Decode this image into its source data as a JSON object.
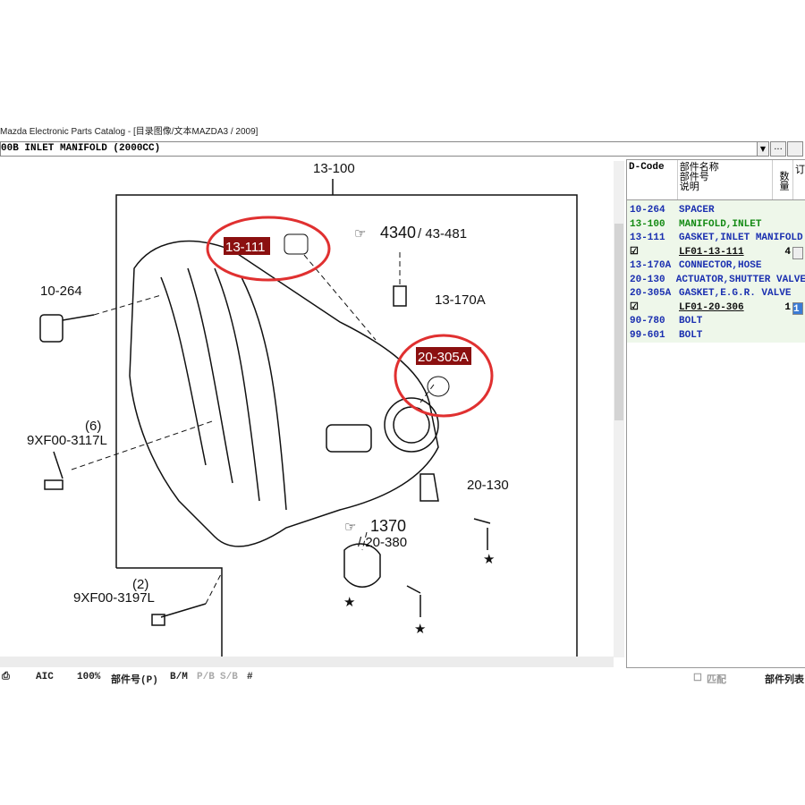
{
  "window": {
    "title": "Mazda Electronic Parts Catalog - [目录图像/文本MAZDA3 / 2009]"
  },
  "combo": {
    "value": "00B  INLET MANIFOLD (2000CC)",
    "more_label": "..."
  },
  "diagram": {
    "labels": {
      "main": "13-100",
      "gasket": "13-111",
      "ref1": "4340",
      "ref1b": "/ 43-481",
      "conn": "13-170A",
      "spacer": "10-264",
      "egr": "20-305A",
      "bolt1": "9XF00-3117L",
      "bolt1qty": "(6)",
      "act": "20-130",
      "ref2": "1370",
      "ref2b": "/ 20-380",
      "bolt2qty": "(2)",
      "bolt2": "9XF00-3197L",
      "star": "★"
    },
    "highlight_color": "#8b1010",
    "circle_color": "#e03030"
  },
  "panel": {
    "headers": {
      "dcode": "D-Code",
      "name": "部件名称",
      "partno": "部件号",
      "desc": "说明",
      "qty": "数量",
      "order": "订"
    },
    "rows": [
      {
        "code": "10-264",
        "name": "SPACER",
        "color": "blue"
      },
      {
        "code": "13-100",
        "name": "MANIFOLD,INLET",
        "color": "green"
      },
      {
        "code": "13-111",
        "name": "GASKET,INLET MANIFOLD",
        "color": "blue"
      },
      {
        "sub": true,
        "checked": true,
        "part": "LF01-13-111",
        "qty": "4",
        "order": ""
      },
      {
        "code": "13-170A",
        "name": "CONNECTOR,HOSE",
        "color": "blue"
      },
      {
        "code": "20-130",
        "name": "ACTUATOR,SHUTTER VALVE",
        "color": "blue"
      },
      {
        "code": "20-305A",
        "name": "GASKET,E.G.R. VALVE",
        "color": "blue"
      },
      {
        "sub": true,
        "checked": true,
        "part": "LF01-20-306",
        "qty": "1",
        "order": "1"
      },
      {
        "code": "90-780",
        "name": "BOLT",
        "color": "blue"
      },
      {
        "code": "99-601",
        "name": "BOLT",
        "color": "blue"
      }
    ]
  },
  "status": {
    "aic": "AIC",
    "zoom": "100%",
    "partno": "部件号(P)",
    "bm": "B/M",
    "pb": "P/B",
    "sb": "S/B",
    "hash": "#",
    "match": "匹配",
    "partlist": "部件列表"
  }
}
